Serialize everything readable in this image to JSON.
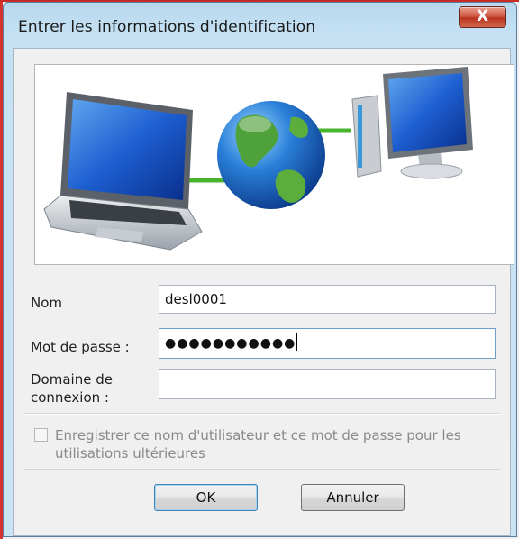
{
  "dialog": {
    "title": "Entrer les informations d'identification",
    "close_symbol": "X"
  },
  "banner": {
    "icons": [
      "laptop-icon",
      "globe-icon",
      "desktop-computer-icon"
    ]
  },
  "form": {
    "username_label": "Nom",
    "username_value": "desl0001",
    "password_label": "Mot de passe :",
    "password_mask": "●●●●●●●●●●●",
    "domain_label_line1": "Domaine de",
    "domain_label_line2": "connexion :",
    "domain_value": ""
  },
  "remember": {
    "label_line1": "Enregistrer ce nom d'utilisateur et ce mot de passe pour les",
    "label_line2": "utilisations ultérieures",
    "checked": false,
    "enabled": false
  },
  "buttons": {
    "ok_label": "OK",
    "cancel_label": "Annuler"
  },
  "colors": {
    "title_bar": "#c6e1f3",
    "close_button": "#c9442e",
    "default_button_border": "#3c7fb1"
  }
}
